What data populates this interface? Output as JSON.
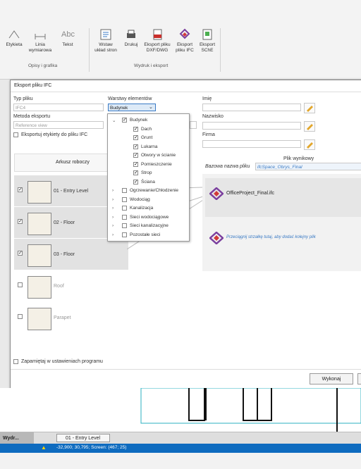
{
  "ribbon": {
    "buttons": [
      {
        "label": "Etykieta",
        "icon": "dimension-icon"
      },
      {
        "label": "Linia\nwymiarowa",
        "icon": "dimension-line-icon"
      },
      {
        "label": "Tekst",
        "icon": "text-icon"
      },
      {
        "label": "Wstaw\nukład stron",
        "icon": "insert-layout-icon"
      },
      {
        "label": "Drukuj",
        "icon": "print-icon"
      },
      {
        "label": "Eksport pliku\nDXF/DWG",
        "icon": "export-dxf-icon"
      },
      {
        "label": "Eksport\npliku IFC",
        "icon": "export-ifc-icon"
      },
      {
        "label": "Eksport\nSChE",
        "icon": "export-sche-icon"
      }
    ],
    "groups": [
      "Opisy i grafika",
      "Wydruk i eksport"
    ]
  },
  "dialog": {
    "title": "Eksport pliku IFC",
    "file_type_label": "Typ pliku",
    "file_type_value": "IFC4",
    "method_label": "Metoda eksportu",
    "method_value": "Reference view",
    "export_labels_checkbox": "Eksportuj etykiety do pliku IFC",
    "layers_label": "Warstwy elementów",
    "layers_value": "Budynek",
    "name_label": "Imię",
    "surname_label": "Nazwisko",
    "company_label": "Firma",
    "output_file_label": "Plik wynikowy",
    "base_name_label": "Bazowa nazwa pliku",
    "base_name_value": "ifcSpace_Obrys_Final",
    "sheet_header": "Arkusz roboczy",
    "sheets": [
      {
        "name": "01 - Entry Level",
        "checked": true
      },
      {
        "name": "02 - Floor",
        "checked": true
      },
      {
        "name": "03 - Floor",
        "checked": true
      },
      {
        "name": "Roof",
        "checked": false
      },
      {
        "name": "Parapet",
        "checked": false
      }
    ],
    "output_file_name": "OfficeProject_Final.ifc",
    "drop_hint": "Przeciągnij strzałkę tutaj, aby dodać kolejny plik",
    "remember_checkbox": "Zapamiętaj w ustawieniach programu",
    "execute_button": "Wykonaj"
  },
  "dropdown": {
    "items": [
      {
        "label": "Budynek",
        "level": 0,
        "expanded": true,
        "checked": true
      },
      {
        "label": "Dach",
        "level": 1,
        "checked": true
      },
      {
        "label": "Grunt",
        "level": 1,
        "checked": true
      },
      {
        "label": "Lukarna",
        "level": 1,
        "checked": true
      },
      {
        "label": "Otwory w ścianie",
        "level": 1,
        "checked": true
      },
      {
        "label": "Pomieszczenie",
        "level": 1,
        "checked": true
      },
      {
        "label": "Strop",
        "level": 1,
        "checked": true
      },
      {
        "label": "Ściana",
        "level": 1,
        "checked": true
      },
      {
        "label": "Ogrzewanie/Chłodzenie",
        "level": 0,
        "expanded": false,
        "checked": false
      },
      {
        "label": "Wodociąg",
        "level": 0,
        "expanded": false,
        "checked": false
      },
      {
        "label": "Kanalizacja",
        "level": 0,
        "expanded": false,
        "checked": false
      },
      {
        "label": "Sieci wodociągowe",
        "level": 0,
        "expanded": false,
        "checked": false
      },
      {
        "label": "Sieci kanalizacyjne",
        "level": 0,
        "expanded": false,
        "checked": false
      },
      {
        "label": "Pozostałe sieci",
        "level": 0,
        "expanded": false,
        "checked": false
      }
    ]
  },
  "bottom": {
    "left_tab": "Wydr...",
    "level_tab": "01 - Entry Level",
    "status_text": "-32,900; 30,795; Screen: (467; 25)"
  },
  "colors": {
    "accent": "#0e6bbf",
    "ifc_logo": "#7b3f9e"
  }
}
